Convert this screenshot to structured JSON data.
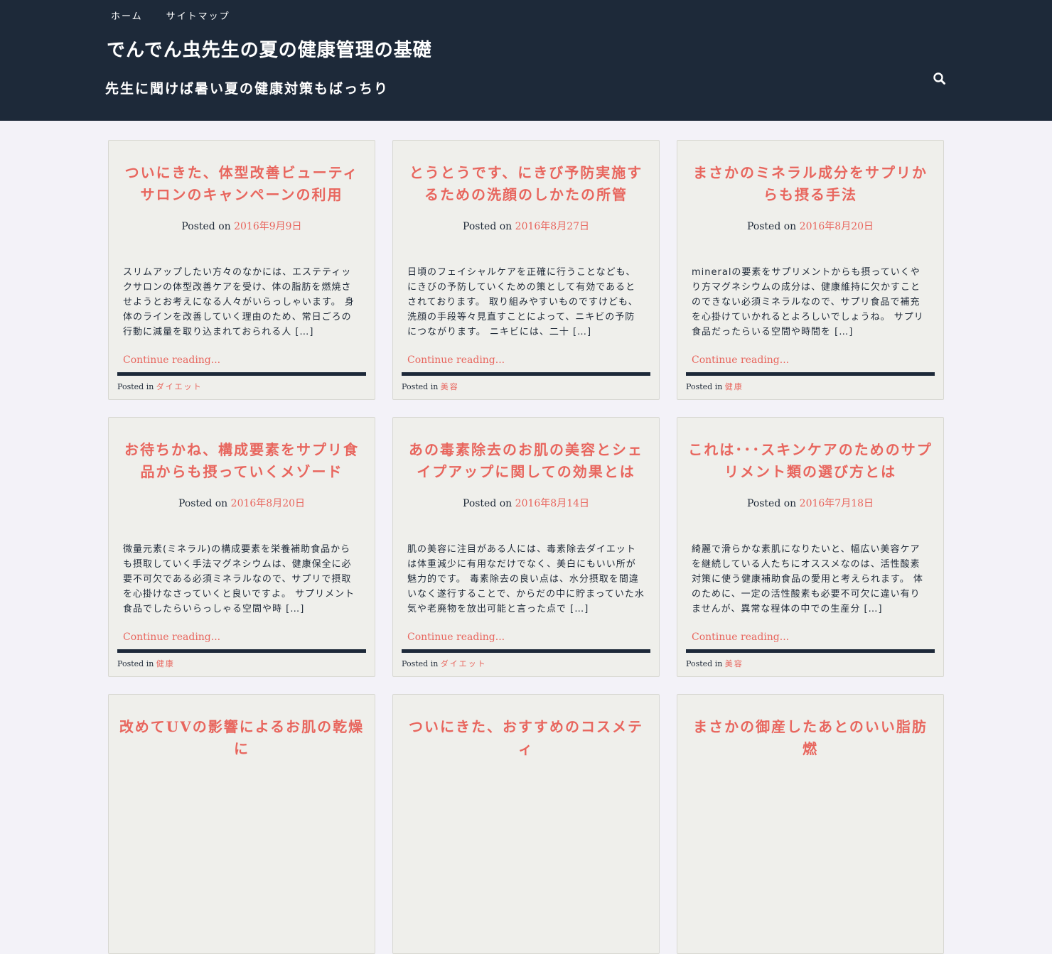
{
  "nav": {
    "items": [
      "ホーム",
      "サイトマップ"
    ]
  },
  "site": {
    "title": "でんでん虫先生の夏の健康管理の基礎",
    "description": "先生に聞けば暑い夏の健康対策もばっちり"
  },
  "search": {
    "icon": "search-icon"
  },
  "labels": {
    "posted_on": "Posted on",
    "continue": "Continue reading...",
    "posted_in": "Posted in"
  },
  "colors": {
    "header": "#1d2939",
    "accent": "#e8665e",
    "card": "#efefeb"
  },
  "posts": [
    {
      "title": "ついにきた、体型改善ビューティサロンのキャンペーンの利用",
      "date": "2016年9月9日",
      "excerpt": "スリムアップしたい方々のなかには、エステティックサロンの体型改善ケアを受け、体の脂肪を燃焼させようとお考えになる人々がいらっしゃいます。 身体のラインを改善していく理由のため、常日ごろの行動に減量を取り込まれておられる人 […]",
      "category": "ダイエット"
    },
    {
      "title": "とうとうです、にきび予防実施するための洗顔のしかたの所管",
      "date": "2016年8月27日",
      "excerpt": "日頃のフェイシャルケアを正確に行うことなども、にきびの予防していくための策として有効であるとされております。 取り組みやすいものですけども、洗顔の手段等々見直すことによって、ニキビの予防につながります。 ニキビには、二十 […]",
      "category": "美容"
    },
    {
      "title": "まさかのミネラル成分をサプリからも摂る手法",
      "date": "2016年8月20日",
      "excerpt": "mineralの要素をサプリメントからも摂っていくやり方マグネシウムの成分は、健康維持に欠かすことのできない必須ミネラルなので、サプリ食品で補充を心掛けていかれるとよろしいでしょうね。 サプリ食品だったらいる空間や時間を […]",
      "category": "健康"
    },
    {
      "title": "お待ちかね、構成要素をサプリ食品からも摂っていくメゾード",
      "date": "2016年8月20日",
      "excerpt": "微量元素(ミネラル)の構成要素を栄養補助食品からも摂取していく手法マグネシウムは、健康保全に必要不可欠である必須ミネラルなので、サプリで摂取を心掛けなさっていくと良いですよ。 サプリメント食品でしたらいらっしゃる空間や時 […]",
      "category": "健康"
    },
    {
      "title": "あの毒素除去のお肌の美容とシェイプアップに関しての効果とは",
      "date": "2016年8月14日",
      "excerpt": "肌の美容に注目がある人には、毒素除去ダイエットは体重減少に有用なだけでなく、美白にもいい所が魅力的です。 毒素除去の良い点は、水分摂取を間違いなく遂行することで、からだの中に貯まっていた水気や老廃物を放出可能と言った点で […]",
      "category": "ダイエット"
    },
    {
      "title": "これは･･･スキンケアのためのサプリメント類の選び方とは",
      "date": "2016年7月18日",
      "excerpt": "綺麗で滑らかな素肌になりたいと、幅広い美容ケアを継続している人たちにオススメなのは、活性酸素対策に使う健康補助食品の愛用と考えられます。 体のために、一定の活性酸素も必要不可欠に違い有りませんが、異常な程体の中での生産分 […]",
      "category": "美容"
    },
    {
      "title": "改めてUVの影響によるお肌の乾燥に",
      "date": "",
      "excerpt": "",
      "category": ""
    },
    {
      "title": "ついにきた、おすすめのコスメティ",
      "date": "",
      "excerpt": "",
      "category": ""
    },
    {
      "title": "まさかの御産したあとのいい脂肪燃",
      "date": "",
      "excerpt": "",
      "category": ""
    }
  ]
}
